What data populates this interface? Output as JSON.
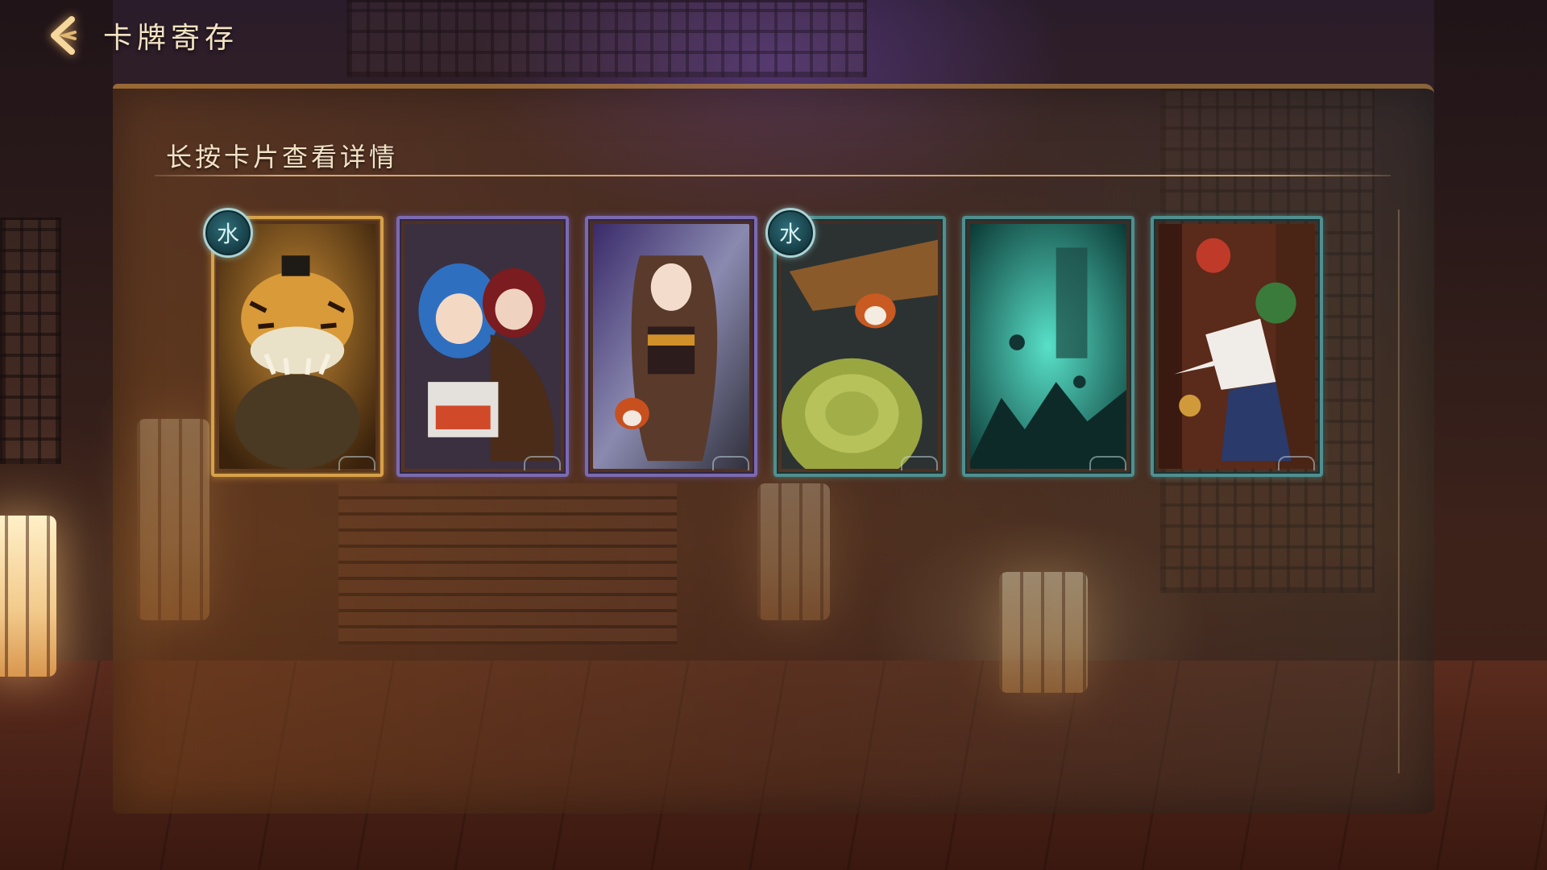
{
  "header": {
    "title": "卡牌寄存",
    "back_icon": "back-arrow-icon"
  },
  "panel": {
    "hint": "长按卡片查看详情"
  },
  "cards": [
    {
      "frame": "gold",
      "badge": "水",
      "art": "tiger-catfish-monster"
    },
    {
      "frame": "purple",
      "badge": "",
      "art": "sleeping-blue-haired-girls"
    },
    {
      "frame": "purple",
      "badge": "",
      "art": "fox-eared-woman-with-red-panda"
    },
    {
      "frame": "teal",
      "badge": "水",
      "art": "red-panda-on-turtle-shell"
    },
    {
      "frame": "teal",
      "badge": "",
      "art": "teal-cave-scene"
    },
    {
      "frame": "teal",
      "badge": "",
      "art": "fox-masked-figure-with-dragon"
    }
  ],
  "colors": {
    "gold_frame": "#d7a14a",
    "purple_frame": "#7b6ab0",
    "teal_frame": "#4f8f90",
    "water_badge": "#2e6f7a"
  }
}
